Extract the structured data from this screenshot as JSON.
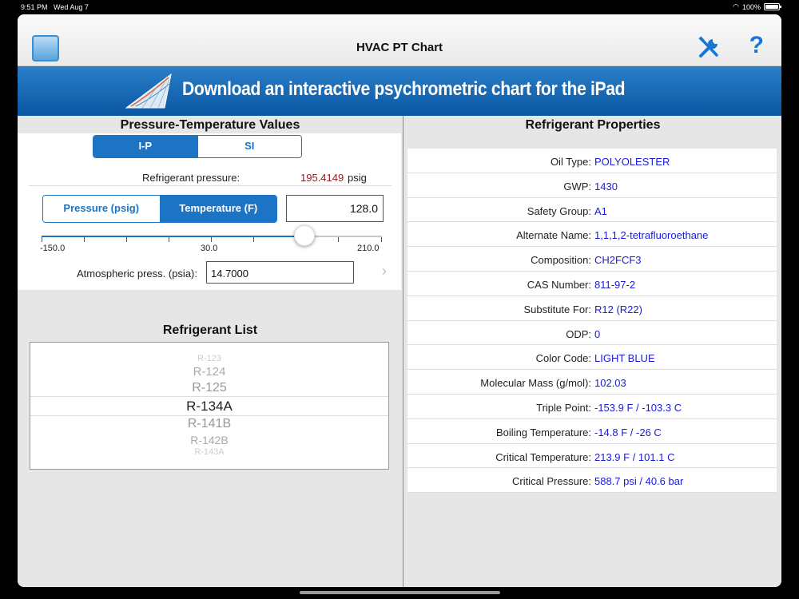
{
  "status": {
    "time": "9:51 PM",
    "date": "Wed Aug 7",
    "battery": "100%"
  },
  "navbar": {
    "title": "HVAC PT Chart",
    "help": "?"
  },
  "banner": {
    "text": "Download an interactive psychrometric chart for the iPad"
  },
  "pt": {
    "title": "Pressure-Temperature Values",
    "units": [
      "I-P",
      "SI"
    ],
    "pressure_label": "Refrigerant pressure:",
    "pressure_value": "195.4149",
    "pressure_unit": "psig",
    "modes": [
      "Pressure (psig)",
      "Temperature (F)"
    ],
    "input_value": "128.0",
    "slider": {
      "min_label": "-150.0",
      "mid_label": "30.0",
      "max_label": "210.0",
      "value": 128.0,
      "min": -150,
      "max": 210
    },
    "atm_label": "Atmospheric press. (psia):",
    "atm_value": "14.7000"
  },
  "list": {
    "title": "Refrigerant List",
    "items": [
      "R-123",
      "R-124",
      "R-125",
      "R-134A",
      "R-141B",
      "R-142B",
      "R-143A"
    ],
    "selected_index": 3
  },
  "props": {
    "title": "Refrigerant Properties",
    "rows": [
      {
        "label": "Oil Type:",
        "value": "POLYOLESTER"
      },
      {
        "label": "GWP:",
        "value": "1430"
      },
      {
        "label": "Safety Group:",
        "value": "A1"
      },
      {
        "label": "Alternate Name:",
        "value": "1,1,1,2-tetrafluoroethane"
      },
      {
        "label": "Composition:",
        "value": "CH2FCF3"
      },
      {
        "label": "CAS Number:",
        "value": "811-97-2"
      },
      {
        "label": "Substitute For:",
        "value": "R12 (R22)"
      },
      {
        "label": "ODP:",
        "value": "0"
      },
      {
        "label": "Color Code:",
        "value": "LIGHT BLUE"
      },
      {
        "label": "Molecular Mass (g/mol):",
        "value": "102.03"
      },
      {
        "label": "Triple Point:",
        "value": "-153.9 F / -103.3 C"
      },
      {
        "label": "Boiling Temperature:",
        "value": "-14.8 F / -26 C"
      },
      {
        "label": "Critical Temperature:",
        "value": "213.9 F / 101.1 C"
      },
      {
        "label": "Critical Pressure:",
        "value": "588.7 psi / 40.6 bar"
      }
    ]
  },
  "colors": {
    "accent": "#1e74c4",
    "value_blue": "#1a1adc",
    "pressure_red": "#8b1d1d",
    "banner": "#1466b4"
  }
}
